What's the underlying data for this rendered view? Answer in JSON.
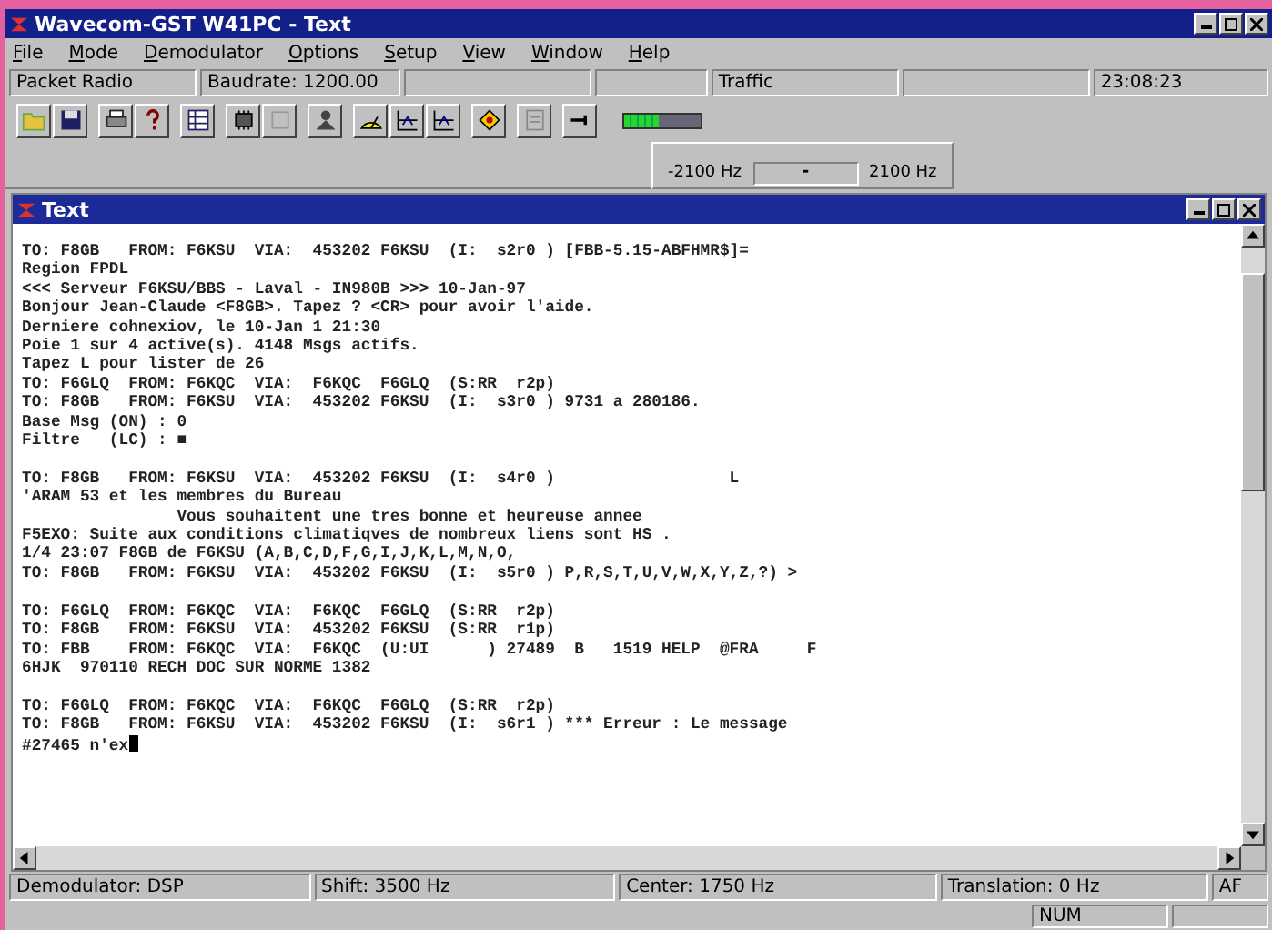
{
  "window": {
    "title": "Wavecom-GST W41PC - Text"
  },
  "menu": [
    {
      "label": "File"
    },
    {
      "label": "Mode"
    },
    {
      "label": "Demodulator"
    },
    {
      "label": "Options"
    },
    {
      "label": "Setup"
    },
    {
      "label": "View"
    },
    {
      "label": "Window"
    },
    {
      "label": "Help"
    }
  ],
  "info_bar": [
    {
      "kind": "text",
      "text": "Packet Radio"
    },
    {
      "kind": "text",
      "text": "Baudrate: 1200.00"
    },
    {
      "kind": "blank"
    },
    {
      "kind": "blank"
    },
    {
      "kind": "text",
      "text": "Traffic"
    },
    {
      "kind": "blank"
    },
    {
      "kind": "text",
      "text": "23:08:23"
    }
  ],
  "toolbar": {
    "meter": {
      "level": 0.45
    }
  },
  "shift_slider": {
    "min_label": "-2100 Hz",
    "max_label": "2100 Hz",
    "thumb": "-",
    "level": 0.5
  },
  "text_window": {
    "title": "Text",
    "blocks": [
      [
        "TO: F8GB   FROM: F6KSU  VIA:  453202 F6KSU  (I:  s2r0 ) [FBB-5.15-ABFHMR$]=",
        "Region FPDL",
        "<<< Serveur F6KSU/BBS - Laval - IN980B >>> 10-Jan-97",
        "Bonjour Jean-Claude <F8GB>. Tapez ? <CR> pour avoir l'aide.",
        "Derniere cohnexiov, le 10-Jan 1 21:30",
        "Poie 1 sur 4 active(s). 4148 Msgs actifs.",
        "Tapez L pour lister de 26",
        "TO: F6GLQ  FROM: F6KQC  VIA:  F6KQC  F6GLQ  (S:RR  r2p)",
        "TO: F8GB   FROM: F6KSU  VIA:  453202 F6KSU  (I:  s3r0 ) 9731 a 280186.",
        "Base Msg (ON) : 0",
        "Filtre   (LC) : ■"
      ],
      [
        "TO: F8GB   FROM: F6KSU  VIA:  453202 F6KSU  (I:  s4r0 )                  L",
        "'ARAM 53 et les membres du Bureau",
        "                Vous souhaitent une tres bonne et heureuse annee",
        "F5EXO: Suite aux conditions climatiqves de nombreux liens sont HS .",
        "1/4 23:07 F8GB de F6KSU (A,B,C,D,F,G,I,J,K,L,M,N,O,",
        "TO: F8GB   FROM: F6KSU  VIA:  453202 F6KSU  (I:  s5r0 ) P,R,S,T,U,V,W,X,Y,Z,?) >"
      ],
      [
        "TO: F6GLQ  FROM: F6KQC  VIA:  F6KQC  F6GLQ  (S:RR  r2p)",
        "TO: F8GB   FROM: F6KSU  VIA:  453202 F6KSU  (S:RR  r1p)",
        "TO: FBB    FROM: F6KQC  VIA:  F6KQC  (U:UI      ) 27489  B   1519 HELP  @FRA     F",
        "6HJK  970110 RECH DOC SUR NORME 1382"
      ],
      [
        "TO: F6GLQ  FROM: F6KQC  VIA:  F6KQC  F6GLQ  (S:RR  r2p)",
        "TO: F8GB   FROM: F6KSU  VIA:  453202 F6KSU  (I:  s6r1 ) *** Erreur : Le message",
        "#27465 n'ex"
      ]
    ]
  },
  "status_bar": [
    {
      "text": "Demodulator: DSP"
    },
    {
      "text": "Shift: 3500 Hz"
    },
    {
      "text": "Center: 1750 Hz"
    },
    {
      "text": "Translation: 0 Hz"
    },
    {
      "text": "AF"
    }
  ],
  "indicator_bar": [
    {
      "text": "NUM"
    }
  ]
}
